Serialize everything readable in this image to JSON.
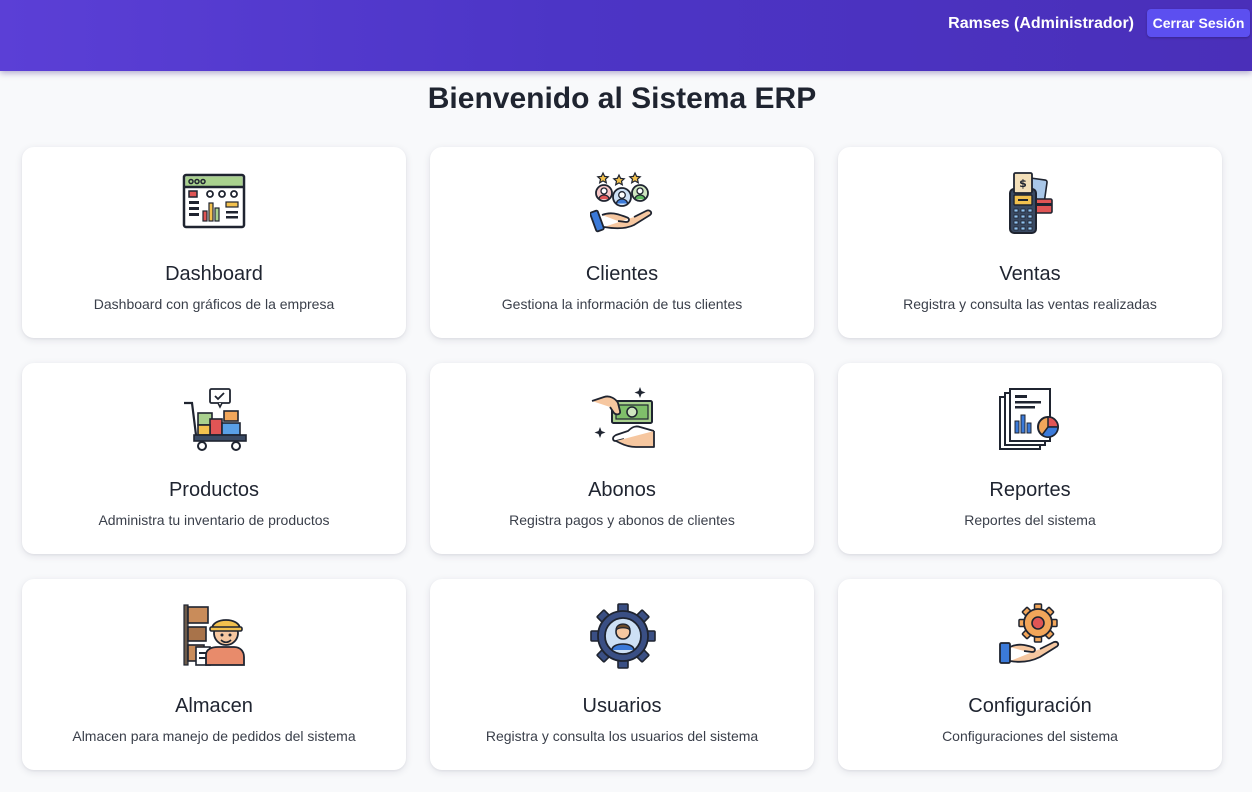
{
  "header": {
    "user": "Ramses (Administrador)",
    "logout_label": "Cerrar Sesión",
    "accent": "#4c35c6"
  },
  "main": {
    "title": "Bienvenido al Sistema ERP",
    "cards": [
      {
        "title": "Dashboard",
        "description": "Dashboard con gráficos de la empresa",
        "icon": "dashboard-icon"
      },
      {
        "title": "Clientes",
        "description": "Gestiona la información de tus clientes",
        "icon": "clients-icon"
      },
      {
        "title": "Ventas",
        "description": "Registra y consulta las ventas realizadas",
        "icon": "pos-terminal-icon"
      },
      {
        "title": "Productos",
        "description": "Administra tu inventario de productos",
        "icon": "cart-icon"
      },
      {
        "title": "Abonos",
        "description": "Registra pagos y abonos de clientes",
        "icon": "payment-icon"
      },
      {
        "title": "Reportes",
        "description": "Reportes del sistema",
        "icon": "reports-icon"
      },
      {
        "title": "Almacen",
        "description": "Almacen para manejo de pedidos del sistema",
        "icon": "warehouse-worker-icon"
      },
      {
        "title": "Usuarios",
        "description": "Registra y consulta los usuarios del sistema",
        "icon": "user-gear-icon"
      },
      {
        "title": "Configuración",
        "description": "Configuraciones del sistema",
        "icon": "settings-gear-icon"
      }
    ]
  }
}
